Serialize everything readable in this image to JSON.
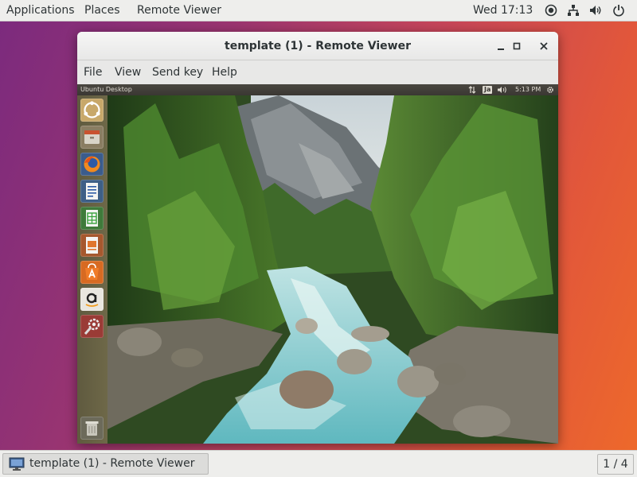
{
  "top_bar": {
    "applications": "Applications",
    "places": "Places",
    "active_app": "Remote Viewer",
    "clock": "Wed 17:13",
    "status_icons": [
      "accessibility-icon",
      "network-icon",
      "volume-icon",
      "power-icon"
    ]
  },
  "window": {
    "title": "template (1) - Remote Viewer",
    "controls": [
      "minimize-icon",
      "maximize-icon",
      "close-icon"
    ],
    "menu": [
      "File",
      "View",
      "Send key",
      "Help"
    ]
  },
  "guest": {
    "panel_title": "Ubuntu Desktop",
    "keyboard_layout": "Ja",
    "time": "5:13 PM",
    "panel_icons": [
      "network-icon",
      "keyboard-icon",
      "volume-icon",
      "gear-icon"
    ],
    "launcher_items": [
      "ubuntu-dash-icon",
      "files-icon",
      "firefox-icon",
      "writer-icon",
      "calc-icon",
      "impress-icon",
      "software-center-icon",
      "amazon-icon",
      "system-settings-icon",
      "trash-icon"
    ]
  },
  "taskbar": {
    "window_label": "template (1) - Remote Viewer",
    "pager": "1 / 4"
  }
}
